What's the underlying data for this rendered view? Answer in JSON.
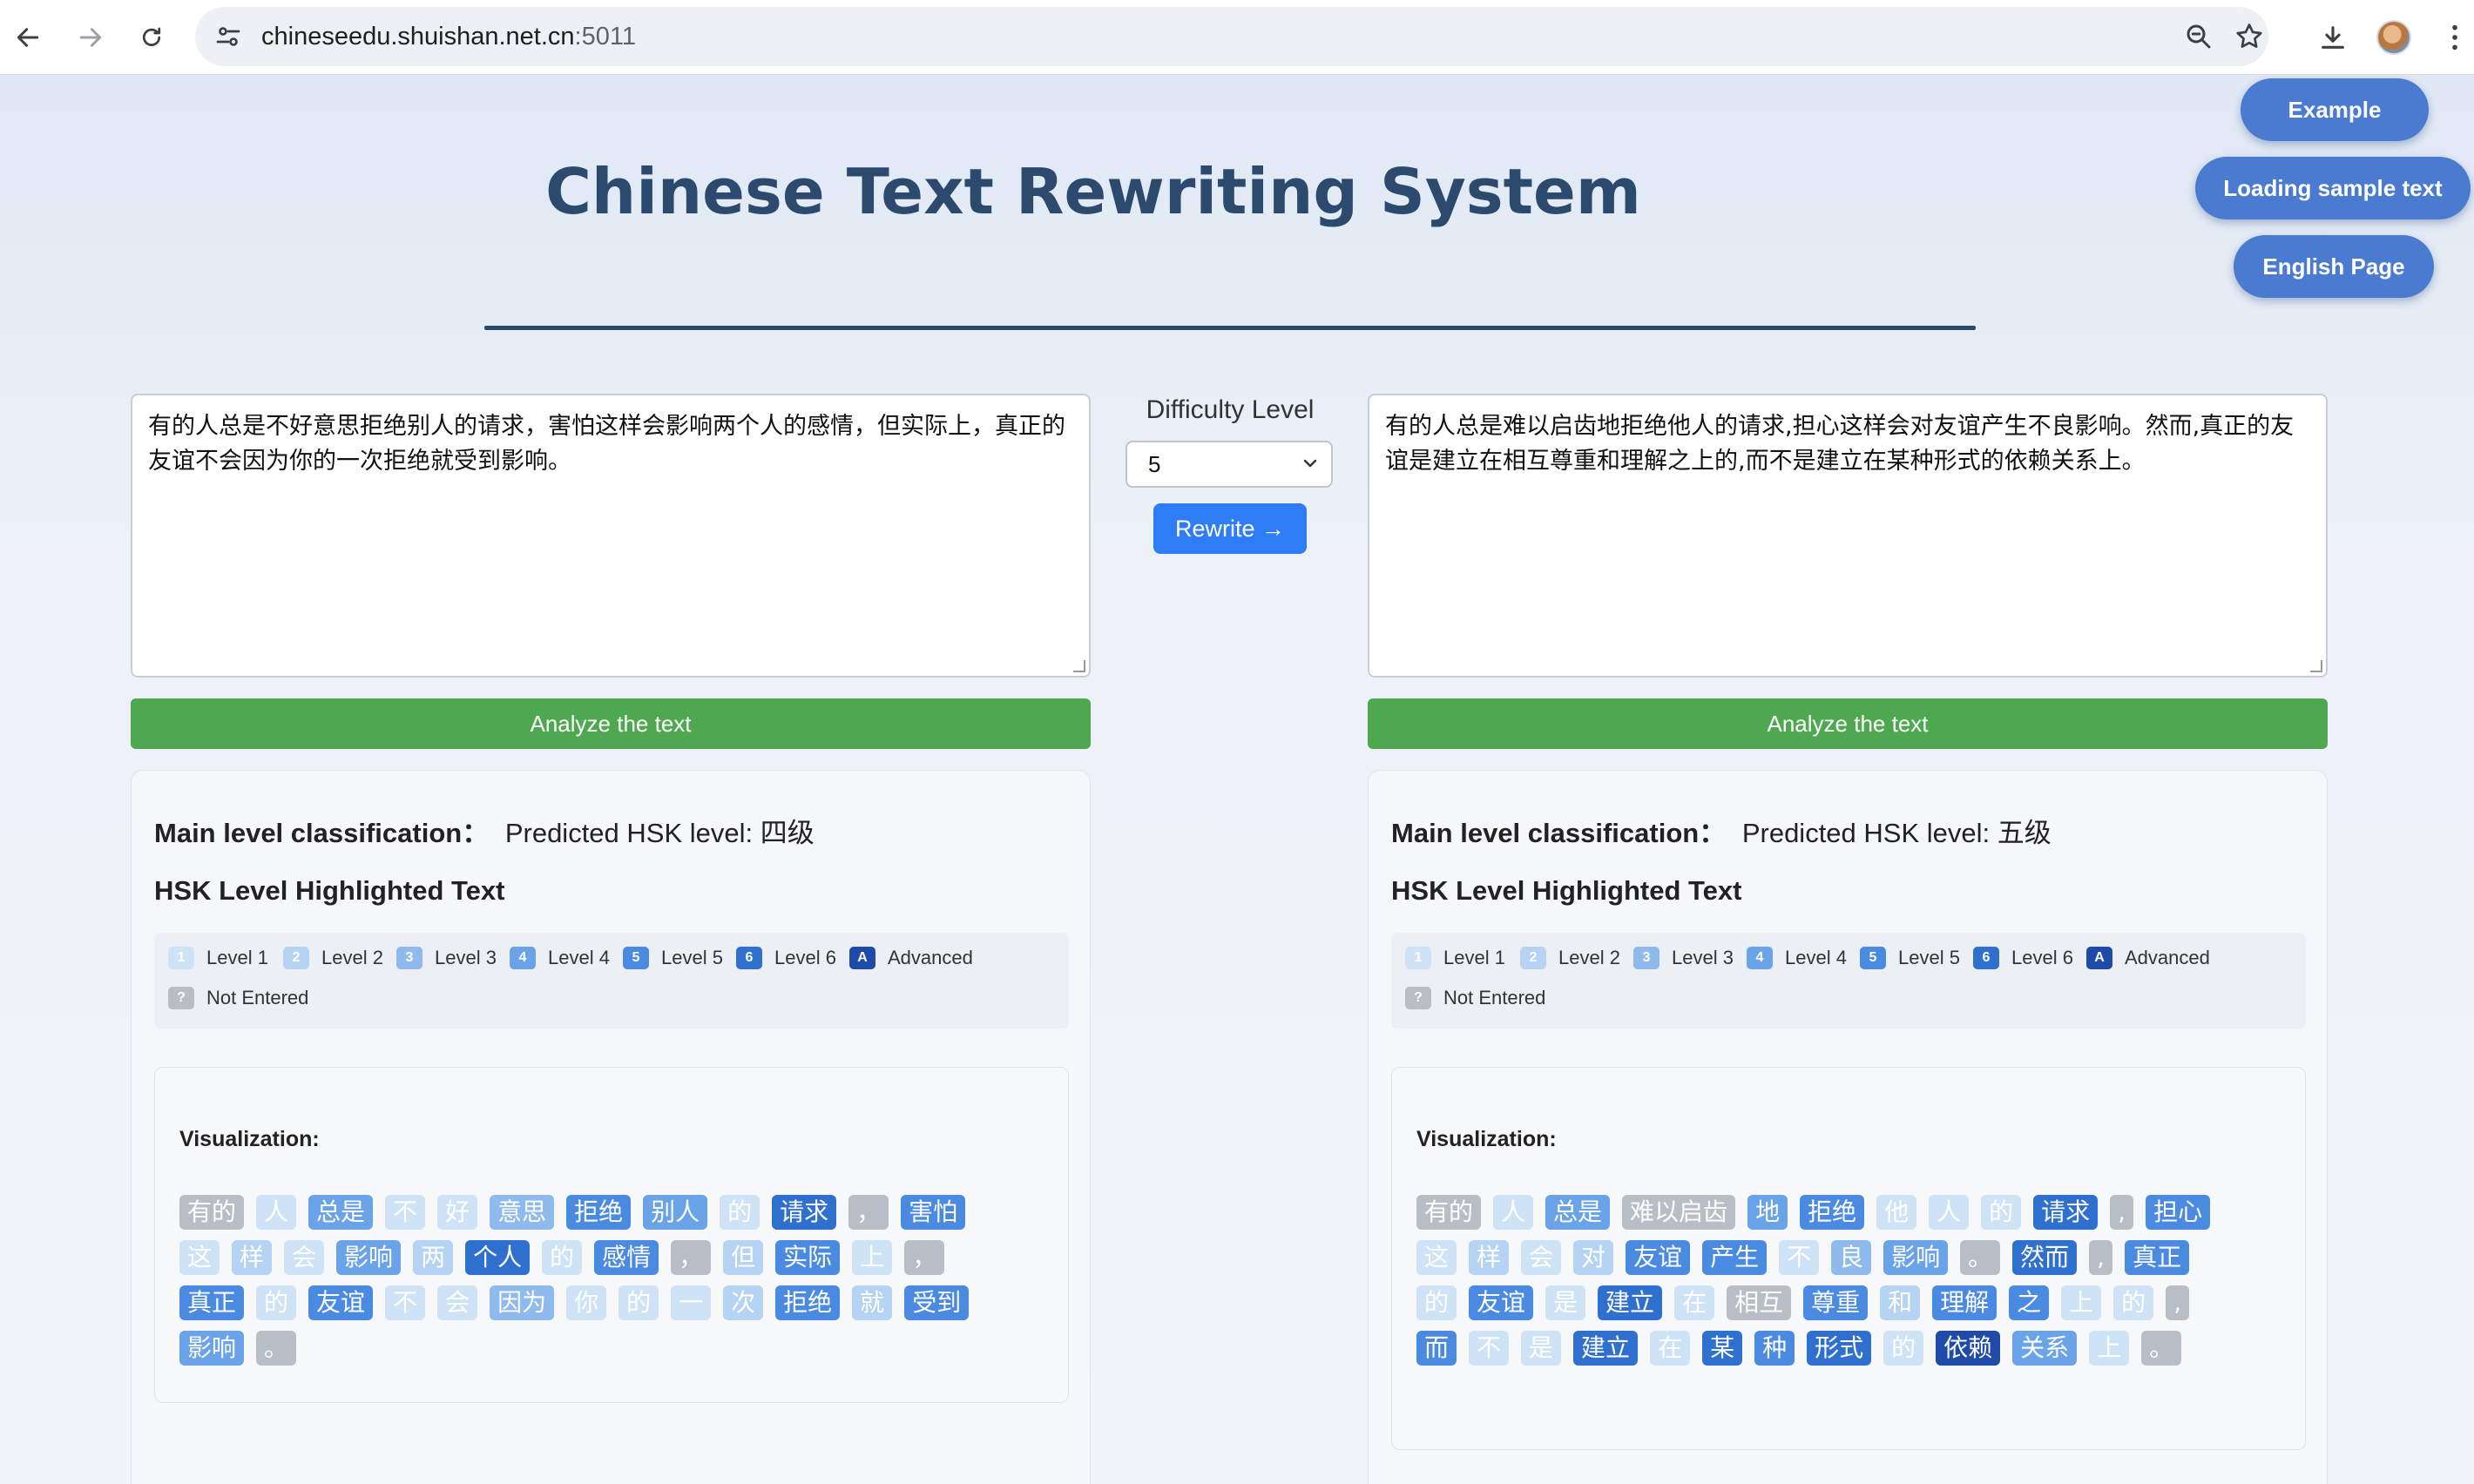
{
  "browser": {
    "url_host": "chineseedu.shuishan.net.cn",
    "url_port": ":5011"
  },
  "header": {
    "title": "Chinese Text Rewriting System",
    "buttons": {
      "example": "Example",
      "loading": "Loading sample text",
      "english": "English Page"
    }
  },
  "controls": {
    "difficulty_label": "Difficulty Level",
    "difficulty_value": "5",
    "rewrite_label": "Rewrite →"
  },
  "input_text": "有的人总是不好意思拒绝别人的请求，害怕这样会影响两个人的感情，但实际上，真正的友谊不会因为你的一次拒绝就受到影响。",
  "output_text": "有的人总是难以启齿地拒绝他人的请求,担心这样会对友谊产生不良影响。然而,真正的友谊是建立在相互尊重和理解之上的,而不是建立在某种形式的依赖关系上。",
  "analyze_label": "Analyze the text",
  "result_labels": {
    "main_level": "Main level classification：",
    "hl_title": "HSK Level Highlighted Text",
    "viz": "Visualization:"
  },
  "left_result": {
    "predicted": "Predicted HSK level: 四级"
  },
  "right_result": {
    "predicted": "Predicted HSK level: 五级"
  },
  "legend": {
    "items": [
      {
        "badge": "1",
        "label": "Level 1"
      },
      {
        "badge": "2",
        "label": "Level 2"
      },
      {
        "badge": "3",
        "label": "Level 3"
      },
      {
        "badge": "4",
        "label": "Level 4"
      },
      {
        "badge": "5",
        "label": "Level 5"
      },
      {
        "badge": "6",
        "label": "Level 6"
      },
      {
        "badge": "A",
        "label": "Advanced"
      },
      {
        "badge": "?",
        "label": "Not Entered"
      }
    ],
    "colors": {
      "l1": "#cfe3f7",
      "l2": "#b5d3f3",
      "l3": "#8fbaee",
      "l4": "#6aa3e8",
      "l5": "#4a8ae0",
      "l6": "#2f6fce",
      "la": "#1e4aa8",
      "lq": "#b9bec6"
    }
  },
  "left_tokens": [
    {
      "t": "有的",
      "l": "lq"
    },
    {
      "t": "人",
      "l": "l1"
    },
    {
      "t": "总是",
      "l": "l4"
    },
    {
      "t": "不",
      "l": "l1"
    },
    {
      "t": "好",
      "l": "l1"
    },
    {
      "t": "意思",
      "l": "l3"
    },
    {
      "t": "拒绝",
      "l": "l5"
    },
    {
      "t": "别人",
      "l": "l4"
    },
    {
      "t": "的",
      "l": "l1"
    },
    {
      "t": "请求",
      "l": "l6"
    },
    {
      "t": "，",
      "l": "lq"
    },
    {
      "t": "害怕",
      "l": "l5"
    },
    {
      "t": "这",
      "l": "l1"
    },
    {
      "t": "样",
      "l": "l2"
    },
    {
      "t": "会",
      "l": "l1"
    },
    {
      "t": "影响",
      "l": "l4"
    },
    {
      "t": "两",
      "l": "l2"
    },
    {
      "t": "个人",
      "l": "l6"
    },
    {
      "t": "的",
      "l": "l1"
    },
    {
      "t": "感情",
      "l": "l5"
    },
    {
      "t": "，",
      "l": "lq"
    },
    {
      "t": "但",
      "l": "l2"
    },
    {
      "t": "实际",
      "l": "l5"
    },
    {
      "t": "上",
      "l": "l1"
    },
    {
      "t": "，",
      "l": "lq"
    },
    {
      "t": "真正",
      "l": "l5"
    },
    {
      "t": "的",
      "l": "l1"
    },
    {
      "t": "友谊",
      "l": "l5"
    },
    {
      "t": "不",
      "l": "l1"
    },
    {
      "t": "会",
      "l": "l1"
    },
    {
      "t": "因为",
      "l": "l3"
    },
    {
      "t": "你",
      "l": "l1"
    },
    {
      "t": "的",
      "l": "l1"
    },
    {
      "t": "一",
      "l": "l1"
    },
    {
      "t": "次",
      "l": "l2"
    },
    {
      "t": "拒绝",
      "l": "l5"
    },
    {
      "t": "就",
      "l": "l2"
    },
    {
      "t": "受到",
      "l": "l5"
    },
    {
      "t": "影响",
      "l": "l4"
    },
    {
      "t": "。",
      "l": "lq"
    }
  ],
  "right_tokens": [
    {
      "t": "有的",
      "l": "lq"
    },
    {
      "t": "人",
      "l": "l1"
    },
    {
      "t": "总是",
      "l": "l4"
    },
    {
      "t": "难以启齿",
      "l": "lq"
    },
    {
      "t": "地",
      "l": "l4"
    },
    {
      "t": "拒绝",
      "l": "l5"
    },
    {
      "t": "他",
      "l": "l1"
    },
    {
      "t": "人",
      "l": "l1"
    },
    {
      "t": "的",
      "l": "l1"
    },
    {
      "t": "请求",
      "l": "l6"
    },
    {
      "t": ",",
      "l": "lq"
    },
    {
      "t": "担心",
      "l": "l5"
    },
    {
      "t": "这",
      "l": "l1"
    },
    {
      "t": "样",
      "l": "l2"
    },
    {
      "t": "会",
      "l": "l1"
    },
    {
      "t": "对",
      "l": "l2"
    },
    {
      "t": "友谊",
      "l": "l5"
    },
    {
      "t": "产生",
      "l": "l5"
    },
    {
      "t": "不",
      "l": "l1"
    },
    {
      "t": "良",
      "l": "l3"
    },
    {
      "t": "影响",
      "l": "l4"
    },
    {
      "t": "。",
      "l": "lq"
    },
    {
      "t": "然而",
      "l": "l6"
    },
    {
      "t": ",",
      "l": "lq"
    },
    {
      "t": "真正",
      "l": "l5"
    },
    {
      "t": "的",
      "l": "l1"
    },
    {
      "t": "友谊",
      "l": "l5"
    },
    {
      "t": "是",
      "l": "l1"
    },
    {
      "t": "建立",
      "l": "l6"
    },
    {
      "t": "在",
      "l": "l1"
    },
    {
      "t": "相互",
      "l": "lq"
    },
    {
      "t": "尊重",
      "l": "l5"
    },
    {
      "t": "和",
      "l": "l2"
    },
    {
      "t": "理解",
      "l": "l5"
    },
    {
      "t": "之",
      "l": "l5"
    },
    {
      "t": "上",
      "l": "l1"
    },
    {
      "t": "的",
      "l": "l1"
    },
    {
      "t": ",",
      "l": "lq"
    },
    {
      "t": "而",
      "l": "l5"
    },
    {
      "t": "不",
      "l": "l1"
    },
    {
      "t": "是",
      "l": "l1"
    },
    {
      "t": "建立",
      "l": "l6"
    },
    {
      "t": "在",
      "l": "l1"
    },
    {
      "t": "某",
      "l": "l6"
    },
    {
      "t": "种",
      "l": "l5"
    },
    {
      "t": "形式",
      "l": "l6"
    },
    {
      "t": "的",
      "l": "l1"
    },
    {
      "t": "依赖",
      "l": "la"
    },
    {
      "t": "关系",
      "l": "l4"
    },
    {
      "t": "上",
      "l": "l1"
    },
    {
      "t": "。",
      "l": "lq"
    }
  ]
}
